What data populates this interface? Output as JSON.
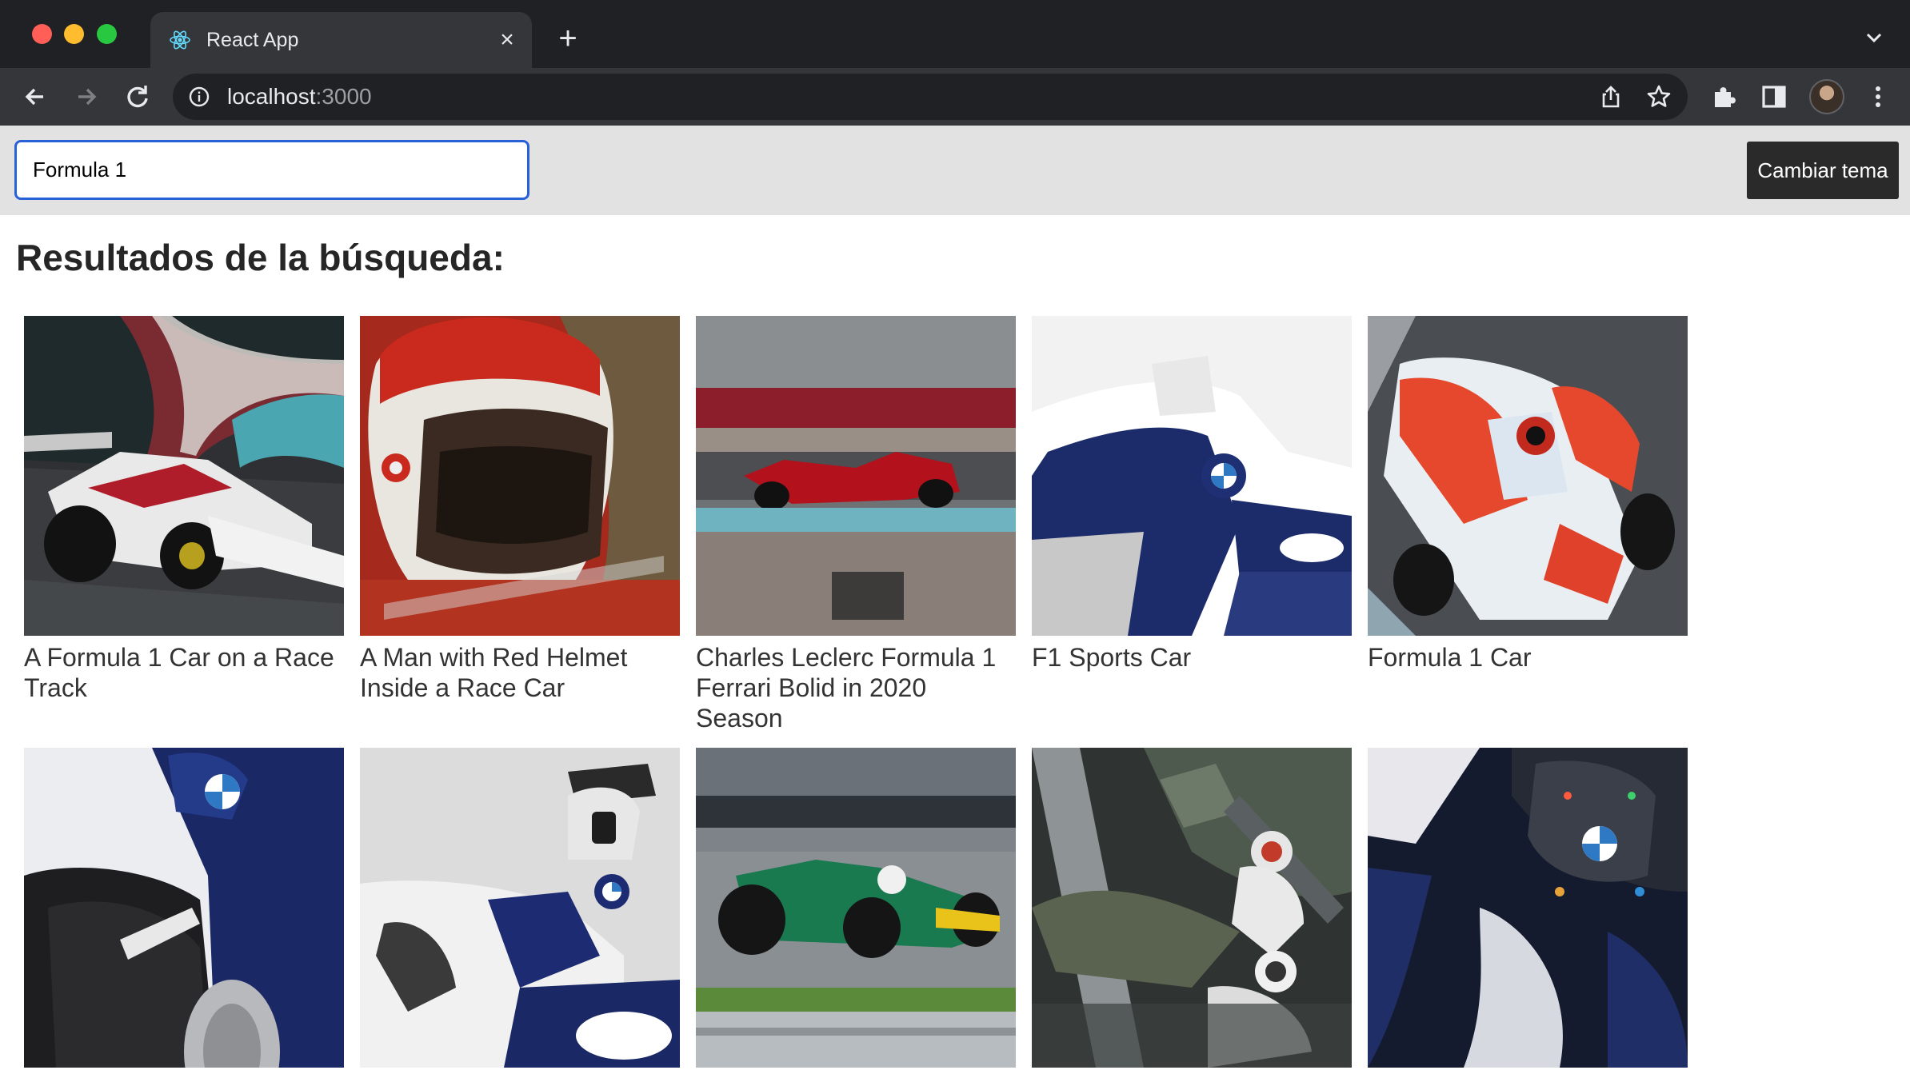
{
  "browser": {
    "tab_title": "React App",
    "tab_close": "×",
    "new_tab": "+",
    "url_host": "localhost",
    "url_port": ":3000"
  },
  "search": {
    "value": "Formula 1",
    "placeholder": ""
  },
  "theme_button_label": "Cambiar tema",
  "results_title": "Resultados de la búsqueda:",
  "results": [
    {
      "caption": "A Formula 1 Car on a Race Track",
      "scene": "track-alfa"
    },
    {
      "caption": "A Man with Red Helmet Inside a Race Car",
      "scene": "helmet"
    },
    {
      "caption": "Charles Leclerc Formula 1 Ferrari Bolid in 2020 Season",
      "scene": "ferrari"
    },
    {
      "caption": "F1 Sports Car",
      "scene": "williams-white"
    },
    {
      "caption": "Formula 1 Car",
      "scene": "formula-e"
    },
    {
      "caption": "",
      "scene": "tyre"
    },
    {
      "caption": "",
      "scene": "williams-side"
    },
    {
      "caption": "",
      "scene": "green-car"
    },
    {
      "caption": "",
      "scene": "pit-crew"
    },
    {
      "caption": "",
      "scene": "cockpit"
    }
  ],
  "colors": {
    "chrome_dark": "#202124",
    "chrome_toolbar": "#35363a",
    "input_focus": "#2860d8",
    "header_bg": "#e2e2e2",
    "button_bg": "#2a2a2a"
  }
}
